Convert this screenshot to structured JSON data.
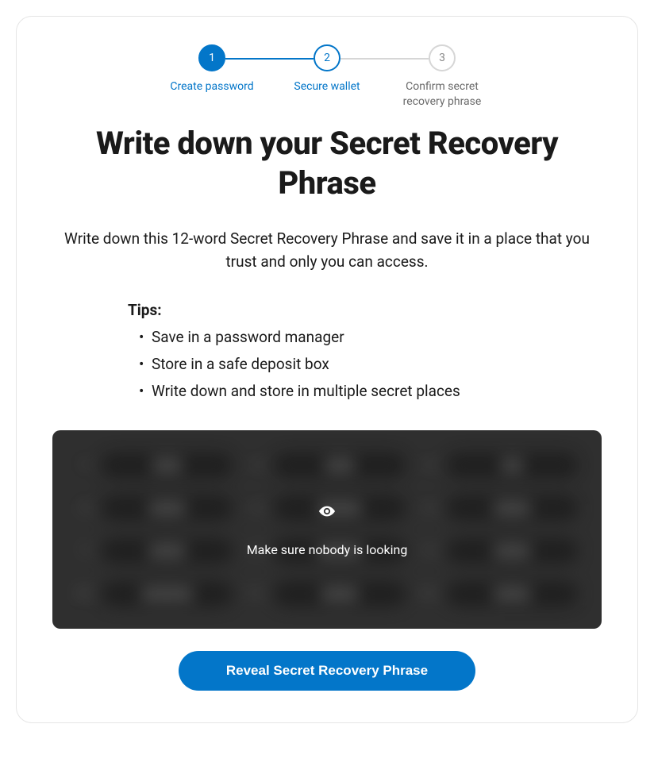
{
  "colors": {
    "primary": "#0376c9",
    "muted": "#d6d6d6",
    "dark_panel": "#2f2f2f"
  },
  "stepper": {
    "steps": [
      {
        "num": "1",
        "label": "Create password",
        "state": "completed"
      },
      {
        "num": "2",
        "label": "Secure wallet",
        "state": "active"
      },
      {
        "num": "3",
        "label": "Confirm secret recovery phrase",
        "state": "pending"
      }
    ]
  },
  "headline": "Write down your Secret Recovery Phrase",
  "subhead": "Write down this 12-word Secret Recovery Phrase and save it in a place that you trust and only you can access.",
  "tips": {
    "heading": "Tips:",
    "items": [
      "Save in a password manager",
      "Store in a safe deposit box",
      "Write down and store in multiple secret places"
    ]
  },
  "phrase_overlay": {
    "icon": "eye-icon",
    "text": "Make sure nobody is looking"
  },
  "phrase_placeholder_count": 12,
  "reveal_button": "Reveal Secret Recovery Phrase"
}
